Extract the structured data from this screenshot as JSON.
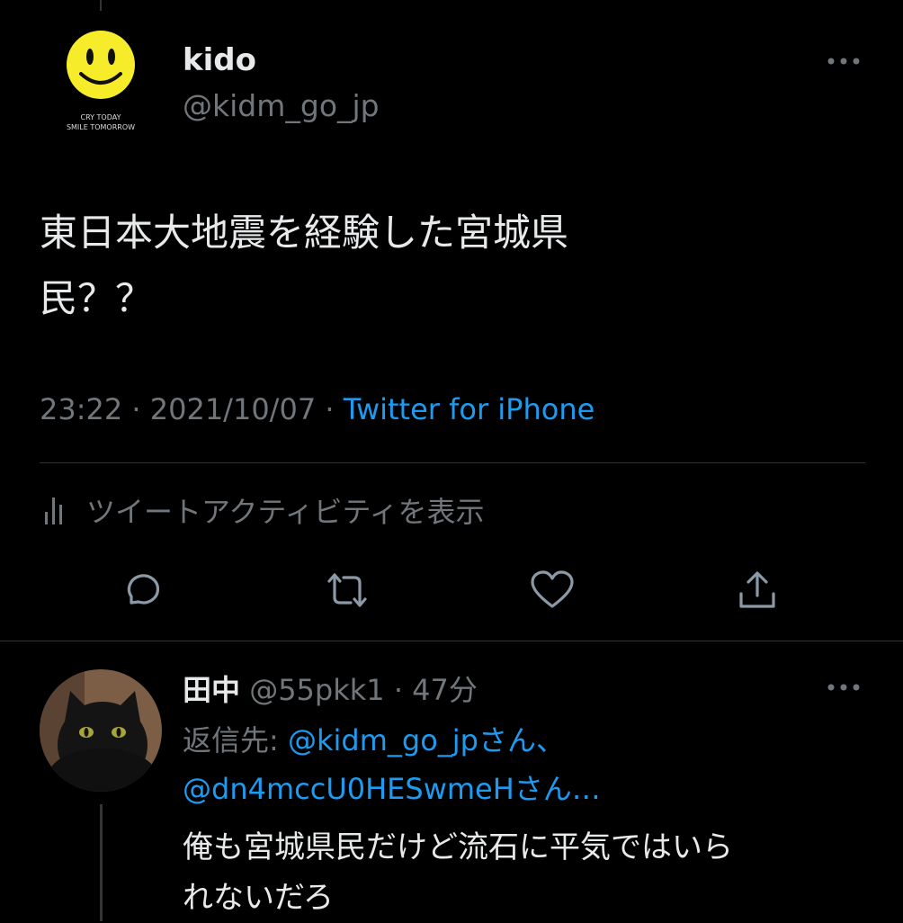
{
  "tweet": {
    "author": {
      "name": "kido",
      "handle": "@kidm_go_jp",
      "avatar_caption_line1": "CRY TODAY",
      "avatar_caption_line2": "SMILE TOMORROW"
    },
    "text_lines": [
      "東日本大地震を経験した宮城県",
      "民？？"
    ],
    "time": "23:22",
    "date": "2021/10/07",
    "source": "Twitter for iPhone",
    "activity_label": "ツイートアクティビティを表示",
    "actions": [
      "reply-icon",
      "retweet-icon",
      "like-icon",
      "share-icon"
    ]
  },
  "reply": {
    "name": "田中",
    "handle": "@55pkk1",
    "time": "47分",
    "reply_prefix": "返信先: ",
    "mention1": "@kidm_go_jpさん、",
    "mention2": "@dn4mccU0HESwmeHさん…",
    "text_lines": [
      "俺も宮城県民だけど流石に平気ではいら",
      "れないだろ"
    ]
  },
  "colors": {
    "background": "#000000",
    "text": "#e7e9ea",
    "secondary": "#71767b",
    "link": "#1d9bf0",
    "divider": "#2f3336",
    "smiley": "#f7ec2a"
  }
}
